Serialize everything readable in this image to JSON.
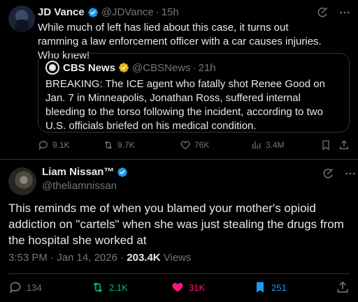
{
  "tweet1": {
    "name": "JD Vance",
    "handle": "@JDVance",
    "time": "15h",
    "text": "While much of left has lied about this case, it turns out ramming a law enforcement officer with a car causes injuries. Who knew!",
    "quote": {
      "name": "CBS News",
      "handle": "@CBSNews",
      "time": "21h",
      "text": "BREAKING: The ICE agent who fatally shot Renee Good on Jan. 7 in Minneapolis, Jonathan Ross, suffered internal bleeding to the torso following the incident, according to two U.S. officials briefed on his medical condition."
    },
    "actions": {
      "replies": "9.1K",
      "reposts": "9.7K",
      "likes": "76K",
      "views": "3.4M"
    }
  },
  "tweet2": {
    "name": "Liam Nissan™",
    "handle": "@theliamnissan",
    "text": "This reminds me of when you blamed your mother's opioid addiction on \"cartels\" when she was just stealing the drugs from the hospital she worked at",
    "time": "3:53 PM · Jan 14, 2026 · ",
    "views_count": "203.4K",
    "views_label": " Views",
    "actions": {
      "replies": "134",
      "reposts": "2.1K",
      "likes": "31K",
      "bookmarks": "251"
    }
  },
  "colors": {
    "text": "#e7e9ea",
    "muted": "#71767b",
    "verified": "#1d9bf0",
    "gold": "#e2b719",
    "repost_active": "#00ba7c",
    "like_active": "#f91880",
    "bookmark_active": "#1d9bf0"
  }
}
